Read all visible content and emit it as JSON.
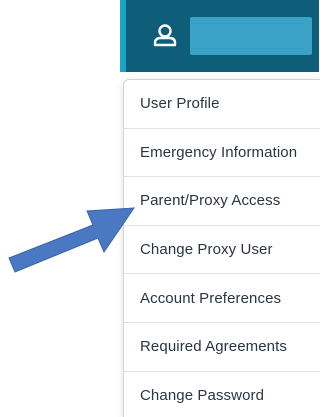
{
  "header": {
    "user_icon": "user-icon"
  },
  "menu": {
    "items": [
      {
        "label": "User Profile"
      },
      {
        "label": "Emergency Information"
      },
      {
        "label": "Parent/Proxy Access"
      },
      {
        "label": "Change Proxy User"
      },
      {
        "label": "Account Preferences"
      },
      {
        "label": "Required Agreements"
      },
      {
        "label": "Change Password"
      }
    ]
  },
  "annotation": {
    "arrow_icon": "arrow-right-icon",
    "arrow_color": "#4a78c2",
    "points_to": "Parent/Proxy Access"
  },
  "colors": {
    "header_bg": "#0e5e79",
    "header_accent": "#1aa5c8",
    "redaction": "#3aa2c6"
  }
}
